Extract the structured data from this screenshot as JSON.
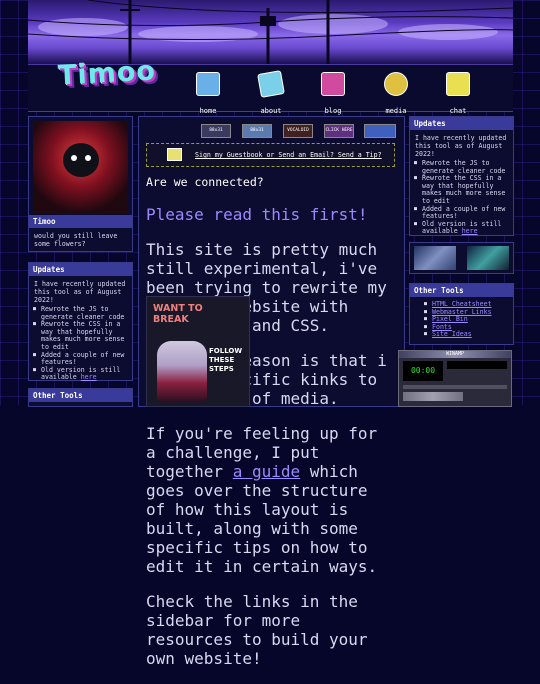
{
  "site": {
    "logo": "Timoo"
  },
  "nav": [
    {
      "label": "home",
      "color": "#6ab0e8"
    },
    {
      "label": "about",
      "color": "#7ad0e8"
    },
    {
      "label": "blog",
      "color": "#d04aa0"
    },
    {
      "label": "media",
      "color": "#e0c040"
    },
    {
      "label": "chat",
      "color": "#e8e050"
    }
  ],
  "profile": {
    "name": "Timoo",
    "text": "would you still leave some flowers?"
  },
  "updates": {
    "title": "Updates",
    "intro": "I have recently updated this tool as of August 2022!",
    "items": [
      "Rewrote the JS to generate cleaner code",
      "Rewrote the CSS in a way that hopefully makes much more sense to edit",
      "Added a couple of new features!"
    ],
    "last_prefix": "Old version is still available ",
    "last_link": "here"
  },
  "other_tools": {
    "title": "Other Tools",
    "links": [
      "HTML Cheatsheet",
      "Webmaster Links",
      "Pixel Bin",
      "Fonts",
      "Site Ideas"
    ]
  },
  "buttons": [
    "88x31",
    "88x31",
    "VOCALOID",
    "CLICK HERE",
    "",
    ""
  ],
  "guestbook": {
    "text": "Sign my Guestbook or Send an Email? Send a Tip?"
  },
  "main": {
    "title": "Are we connected?",
    "notice": "Please read this first!",
    "p1": "This site is pretty much still experimental, i've been trying to rewrite my personal website with pure HTML, and CSS.",
    "p2": "The main reason is that i have a specific kinks to these kind of media.",
    "p3_pre": "If you're feeling up for a challenge, I put together ",
    "p3_link": "a guide",
    "p3_post": " which goes over the structure of how this layout is built, along with some specific tips on how to edit it in certain ways.",
    "p4": "Check the links in the sidebar for more resources to build your own website!",
    "poster_top": "WANT TO BREAK",
    "poster_side": "FOLLOW THESE STEPS"
  },
  "winamp": {
    "title": "WINAMP",
    "time": "00:00"
  },
  "colors": {
    "accent": "#3a3a9a",
    "link": "#9a8aff",
    "bg": "#06062a"
  }
}
